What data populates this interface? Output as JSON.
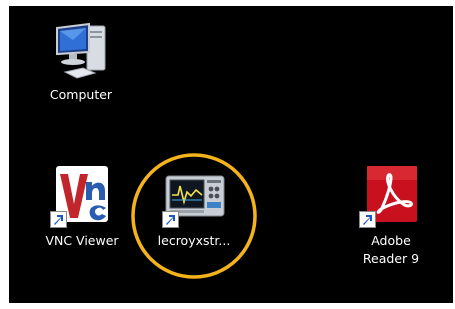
{
  "desktop": {
    "icons": [
      {
        "label": "Computer",
        "icon": "computer-icon"
      },
      {
        "label": "VNC Viewer",
        "icon": "vnc-viewer-icon"
      },
      {
        "label": "lecroyxstr...",
        "icon": "oscilloscope-icon"
      },
      {
        "label": "Adobe Reader 9",
        "label_line1": "Adobe",
        "label_line2": "Reader 9",
        "icon": "adobe-reader-icon"
      }
    ]
  },
  "colors": {
    "background": "#000000",
    "highlight_circle": "#f5b31b",
    "adobe_red": "#c8101e",
    "vnc_red": "#c0262c",
    "vnc_blue": "#2a5db0"
  }
}
